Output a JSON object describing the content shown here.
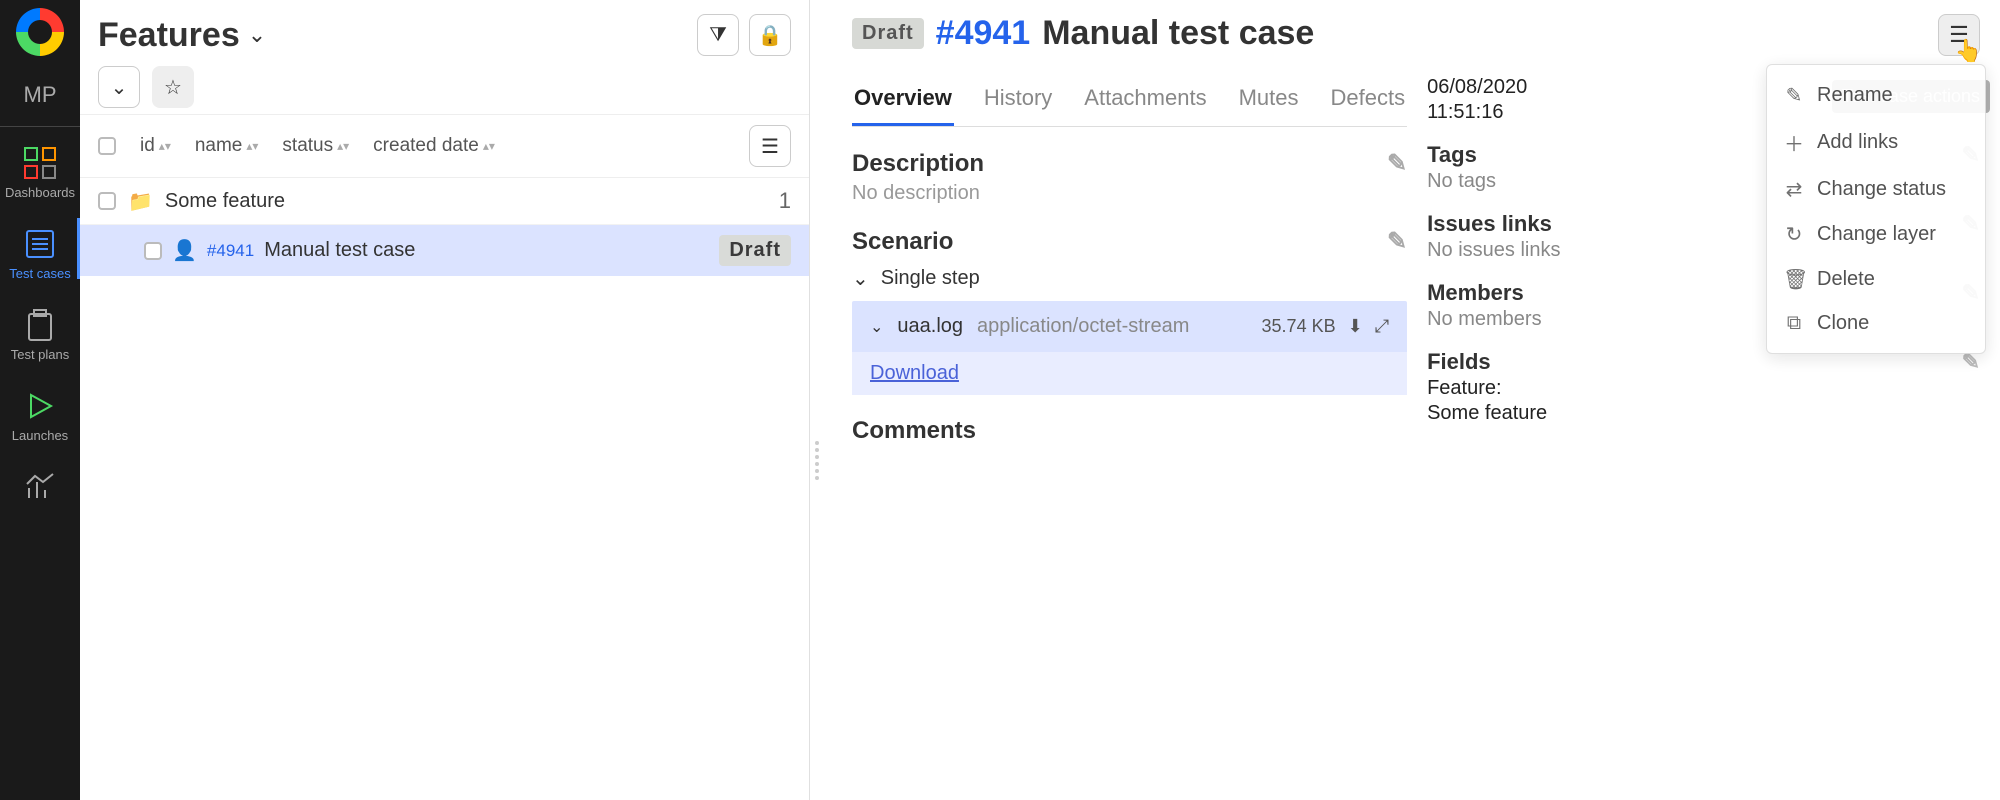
{
  "sidebar": {
    "workspace": "MP",
    "items": [
      {
        "label": "Dashboards"
      },
      {
        "label": "Test cases"
      },
      {
        "label": "Test plans"
      },
      {
        "label": "Launches"
      }
    ]
  },
  "left": {
    "title": "Features",
    "columns": [
      "id",
      "name",
      "status",
      "created date"
    ],
    "feature": {
      "name": "Some feature",
      "count": "1"
    },
    "testcase": {
      "id": "#4941",
      "name": "Manual test case",
      "status": "Draft"
    }
  },
  "right": {
    "status": "Draft",
    "id": "#4941",
    "title": "Manual test case",
    "tabs": [
      "Overview",
      "History",
      "Attachments",
      "Mutes",
      "Defects"
    ],
    "description": {
      "heading": "Description",
      "value": "No description"
    },
    "scenario": {
      "heading": "Scenario",
      "step": "Single step",
      "attachment": {
        "name": "uaa.log",
        "mime": "application/octet-stream",
        "size": "35.74 KB",
        "download": "Download"
      }
    },
    "comments_heading": "Comments",
    "tooltip": "Test case actions",
    "menu": [
      {
        "icon": "✎",
        "label": "Rename"
      },
      {
        "icon": "＋",
        "label": "Add links"
      },
      {
        "icon": "⇄",
        "label": "Change status"
      },
      {
        "icon": "↻",
        "label": "Change layer"
      },
      {
        "icon": "🗑",
        "label": "Delete"
      },
      {
        "icon": "⧉",
        "label": "Clone"
      }
    ],
    "side": {
      "created": {
        "date": "06/08/2020",
        "time": "11:51:16"
      },
      "tags": {
        "heading": "Tags",
        "value": "No tags"
      },
      "issues": {
        "heading": "Issues links",
        "value": "No issues links"
      },
      "members": {
        "heading": "Members",
        "value": "No members"
      },
      "fields": {
        "heading": "Fields",
        "label": "Feature:",
        "value": "Some feature"
      }
    }
  }
}
